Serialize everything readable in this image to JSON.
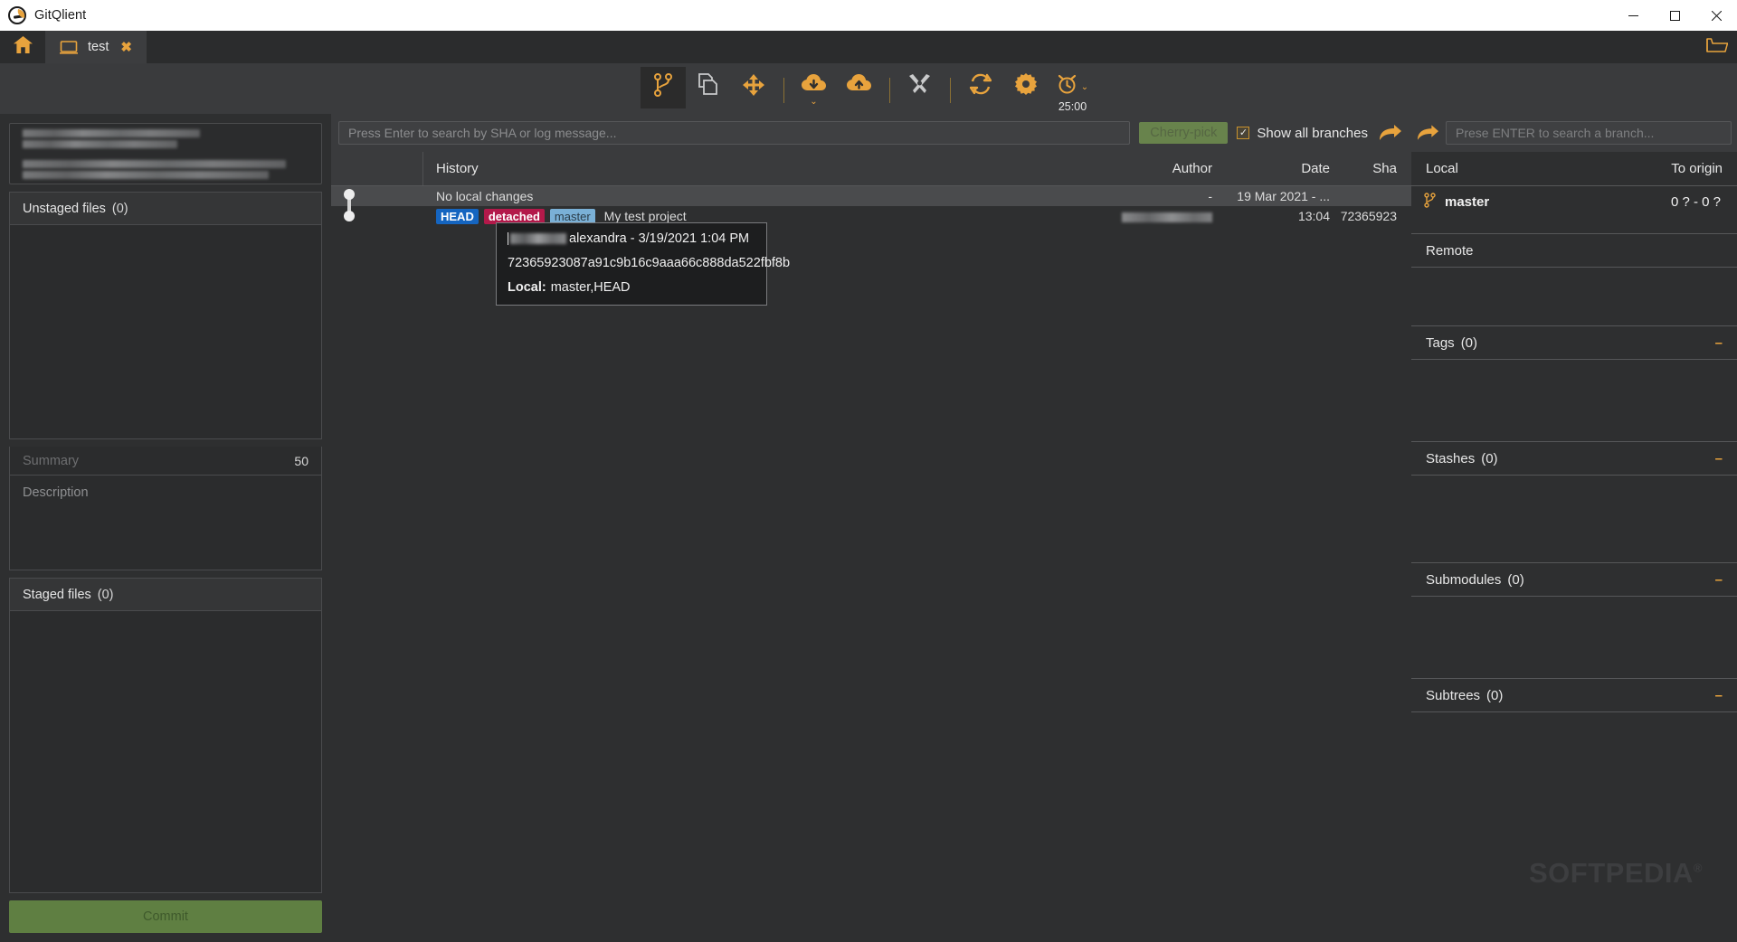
{
  "window": {
    "title": "GitQlient",
    "controls": {
      "minimize": "minimize-icon",
      "maximize": "maximize-icon",
      "close": "close-icon"
    }
  },
  "tabs": {
    "home_icon": "home-icon",
    "items": [
      {
        "label": "test",
        "icon": "monitor-icon",
        "close": "✖"
      }
    ],
    "open_folder_icon": "open-folder-icon"
  },
  "toolbar": {
    "buttons": [
      {
        "name": "branch-graph",
        "icon": "git-branch-icon",
        "active": true
      },
      {
        "name": "diff-view",
        "icon": "copy-files-icon",
        "active": false
      },
      {
        "name": "blame-view",
        "icon": "move-arrows-icon",
        "active": false
      },
      {
        "name": "pull",
        "icon": "cloud-download-icon",
        "active": false,
        "caret": "⌄"
      },
      {
        "name": "push",
        "icon": "cloud-upload-icon",
        "active": false
      },
      {
        "name": "merge-tools",
        "icon": "tools-icon",
        "active": false
      },
      {
        "name": "refresh",
        "icon": "refresh-icon",
        "active": false
      },
      {
        "name": "settings",
        "icon": "gear-icon",
        "active": false
      }
    ],
    "timer": {
      "icon": "alarm-clock-icon",
      "caret": "⌄",
      "value": "25:00"
    }
  },
  "left": {
    "repo_info_redacted": true,
    "unstaged": {
      "label": "Unstaged files",
      "count": "(0)"
    },
    "summary": {
      "placeholder": "Summary",
      "char_count": "50"
    },
    "description": {
      "placeholder": "Description"
    },
    "staged": {
      "label": "Staged files",
      "count": "(0)"
    },
    "commit_button": "Commit"
  },
  "center": {
    "search": {
      "placeholder": "Press Enter to search by SHA or log message..."
    },
    "cherry_pick": "Cherry-pick",
    "show_all_branches": {
      "label": "Show all branches",
      "checked": true
    },
    "goto_branch_icon": "goto-branch-icon",
    "columns": [
      "History",
      "Author",
      "Date",
      "Sha"
    ],
    "rows": [
      {
        "history": "No local changes",
        "badges": [],
        "author": "-",
        "author_redacted": false,
        "date": "19 Mar 2021 - ...",
        "sha": "",
        "selected": true
      },
      {
        "history": "My test project",
        "badges": [
          {
            "text": "HEAD",
            "kind": "head"
          },
          {
            "text": "detached",
            "kind": "detached"
          },
          {
            "text": "master",
            "kind": "master"
          }
        ],
        "author": "",
        "author_redacted": true,
        "date": "13:04",
        "sha": "72365923",
        "selected": false
      }
    ],
    "tooltip": {
      "author_suffix": "alexandra - 3/19/2021 1:04 PM",
      "sha_full": "72365923087a91c9b16c9aaa66c888da522fbf8b",
      "local_label": "Local:",
      "local_value": "master,HEAD"
    }
  },
  "right": {
    "branch_search": {
      "placeholder": "Prese ENTER to search a branch..."
    },
    "local": {
      "title": "Local",
      "to_origin_header": "To origin",
      "branches": [
        {
          "icon": "branch-icon",
          "name": "master",
          "to_origin": "0 ? - 0 ?"
        }
      ]
    },
    "remote": {
      "title": "Remote"
    },
    "tags": {
      "title": "Tags",
      "count": "(0)",
      "collapse": "–"
    },
    "stashes": {
      "title": "Stashes",
      "count": "(0)",
      "collapse": "–"
    },
    "submodules": {
      "title": "Submodules",
      "count": "(0)",
      "collapse": "–"
    },
    "subtrees": {
      "title": "Subtrees",
      "count": "(0)",
      "collapse": "–"
    }
  },
  "watermark": {
    "text": "SOFTPEDIA",
    "mark": "®"
  },
  "colors": {
    "accent": "#e8a33d",
    "bg_dark": "#2e2f30",
    "bg_panel": "#2b2c2d",
    "bg_toolbar": "#3a3b3d",
    "commit_green": "#5f7f42",
    "head_blue": "#1565c0",
    "detached_red": "#b3194a",
    "master_lightblue": "#7ab0d6"
  }
}
